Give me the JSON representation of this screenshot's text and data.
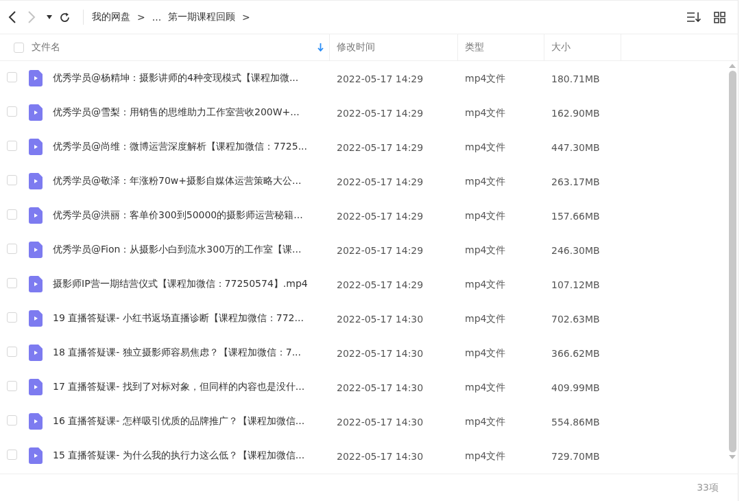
{
  "breadcrumb": [
    "我的网盘",
    ">",
    "...",
    "第一期课程回顾",
    ">"
  ],
  "columns": [
    {
      "label": "文件名"
    },
    {
      "label": "修改时间"
    },
    {
      "label": "类型"
    },
    {
      "label": "大小"
    }
  ],
  "select_all": {
    "checked": false
  },
  "rows": [
    {
      "name": "优秀学员@杨精坤：摄影讲师的4种变现模式【课程加微...",
      "modified": "2022-05-17 14:29",
      "type": "mp4文件",
      "size": "180.71MB",
      "checked": false
    },
    {
      "name": "优秀学员@雪梨：用销售的思维助力工作室营收200W+...",
      "modified": "2022-05-17 14:29",
      "type": "mp4文件",
      "size": "162.90MB",
      "checked": false
    },
    {
      "name": "优秀学员@尚维：微博运营深度解析【课程加微信：7725...",
      "modified": "2022-05-17 14:29",
      "type": "mp4文件",
      "size": "447.30MB",
      "checked": false
    },
    {
      "name": "优秀学员@敬泽：年涨粉70w+摄影自媒体运营策略大公...",
      "modified": "2022-05-17 14:29",
      "type": "mp4文件",
      "size": "263.17MB",
      "checked": false
    },
    {
      "name": "优秀学员@洪丽：客单价300到50000的摄影师运营秘籍...",
      "modified": "2022-05-17 14:29",
      "type": "mp4文件",
      "size": "157.66MB",
      "checked": false
    },
    {
      "name": "优秀学员@Fion：从摄影小白到流水300万的工作室【课...",
      "modified": "2022-05-17 14:29",
      "type": "mp4文件",
      "size": "246.30MB",
      "checked": false
    },
    {
      "name": "摄影师IP营一期结营仪式【课程加微信：77250574】.mp4",
      "modified": "2022-05-17 14:29",
      "type": "mp4文件",
      "size": "107.12MB",
      "checked": false
    },
    {
      "name": "19 直播答疑课- 小红书返场直播诊断【课程加微信：772...",
      "modified": "2022-05-17 14:30",
      "type": "mp4文件",
      "size": "702.63MB",
      "checked": false
    },
    {
      "name": "18 直播答疑课- 独立摄影师容易焦虑？【课程加微信：7...",
      "modified": "2022-05-17 14:30",
      "type": "mp4文件",
      "size": "366.62MB",
      "checked": false
    },
    {
      "name": "17 直播答疑课- 找到了对标对象，但同样的内容也是没什...",
      "modified": "2022-05-17 14:30",
      "type": "mp4文件",
      "size": "409.99MB",
      "checked": false
    },
    {
      "name": "16 直播答疑课- 怎样吸引优质的品牌推广？【课程加微信...",
      "modified": "2022-05-17 14:30",
      "type": "mp4文件",
      "size": "554.86MB",
      "checked": false
    },
    {
      "name": "15 直播答疑课- 为什么我的执行力这么低？【课程加微信...",
      "modified": "2022-05-17 14:30",
      "type": "mp4文件",
      "size": "729.70MB",
      "checked": false
    }
  ],
  "item_count": "33项"
}
